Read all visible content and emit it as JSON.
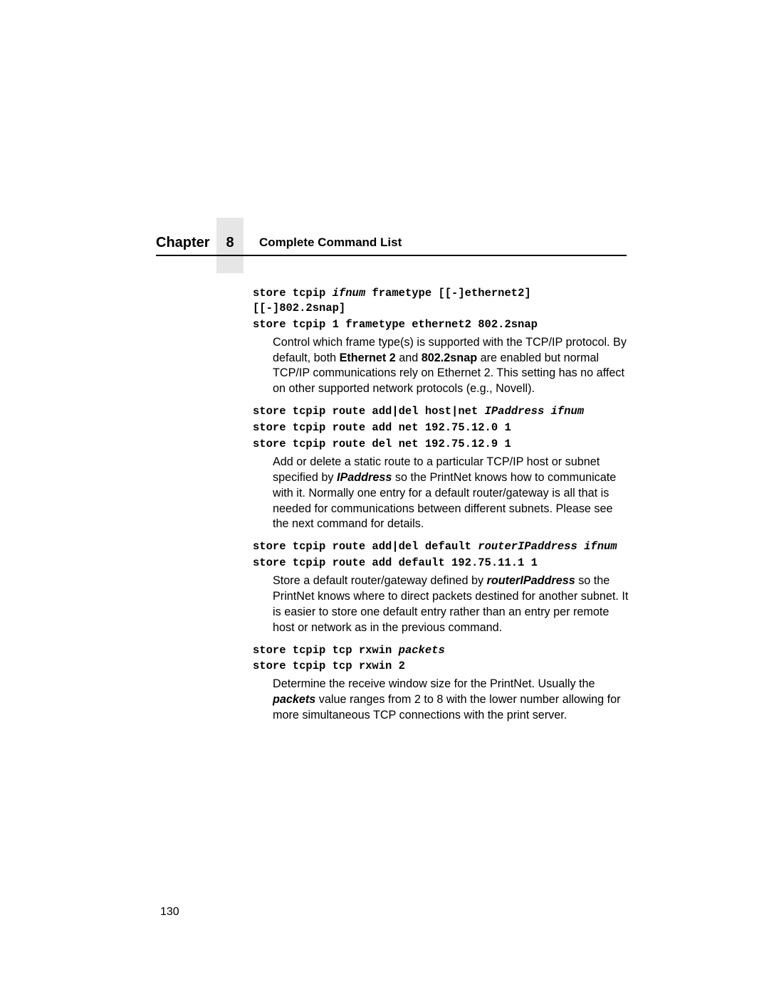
{
  "header": {
    "chapter_word": "Chapter",
    "chapter_number": "8",
    "section_title": "Complete Command List"
  },
  "commands": {
    "frametype": {
      "syntax_pre": "store tcpip ",
      "syntax_param1": "ifnum",
      "syntax_post": " frametype [[-]ethernet2] [[-]802.2snap]",
      "example": "store tcpip 1 frametype ethernet2 802.2snap",
      "desc_pre": "Control which frame type(s) is supported with the TCP/IP protocol. By default, both ",
      "desc_strong1": "Ethernet 2",
      "desc_mid1": " and ",
      "desc_strong2": "802.2snap",
      "desc_post": " are enabled but normal TCP/IP communications rely on Ethernet 2. This setting has no affect on other supported network protocols (e.g., Novell)."
    },
    "route": {
      "syntax_pre": "store tcpip route add|del host|net ",
      "syntax_param1": "IPaddress ifnum",
      "example1": "store tcpip route add net 192.75.12.0 1",
      "example2": "store tcpip route del net 192.75.12.9 1",
      "desc_pre": "Add or delete a static route to a particular TCP/IP host or subnet specified by ",
      "desc_param": "IPaddress",
      "desc_post": " so the PrintNet knows how to communicate with it. Normally one entry for a default router/gateway is all that is needed for communications between different subnets. Please see the next command for details."
    },
    "default_route": {
      "syntax_pre": "store tcpip route add|del default ",
      "syntax_param1": "routerIPaddress ifnum",
      "example": "store tcpip route add default 192.75.11.1 1",
      "desc_pre": "Store a default router/gateway defined by ",
      "desc_param": "routerIPaddress",
      "desc_post": " so the PrintNet knows where to direct packets destined for another subnet. It is easier to store one default entry rather than an entry per remote host or network as in the previous command."
    },
    "rxwin": {
      "syntax_pre": "store tcpip tcp rxwin ",
      "syntax_param1": "packets",
      "example": "store tcpip tcp rxwin 2",
      "desc_pre": "Determine the receive window size for the PrintNet. Usually the ",
      "desc_param": "packets",
      "desc_post": " value ranges from 2 to 8 with the lower number allowing for more simultaneous TCP connections with the print server."
    }
  },
  "page_number": "130"
}
